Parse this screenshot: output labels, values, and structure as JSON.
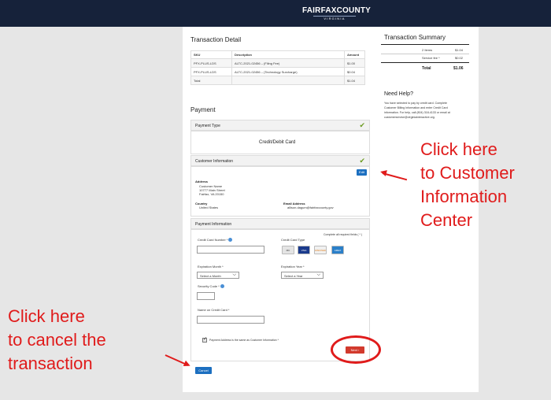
{
  "logo": {
    "main": "FAIRFAXCOUNTY",
    "sub": "VIRGINIA"
  },
  "transaction_detail": {
    "title": "Transaction Detail",
    "columns": [
      "SKU",
      "Description",
      "Amount"
    ],
    "rows": [
      {
        "sku": "PFX-PLUS-LDS",
        "description": "ALTC-2021-02456 – (Filing Fee)",
        "amount": "$1.00"
      },
      {
        "sku": "PFX-PLUS-LDS",
        "description": "ALTC-2021-02456 – (Technology Surcharge)",
        "amount": "$0.04"
      },
      {
        "sku": "Total",
        "description": "",
        "amount": "$1.04"
      }
    ]
  },
  "summary": {
    "title": "Transaction Summary",
    "items_label": "2 Items",
    "items_value": "$1.04",
    "fee_label": "Service fee *",
    "fee_value": "$0.02",
    "total_label": "Total",
    "total_value": "$1.06"
  },
  "help": {
    "title": "Need Help?",
    "body_1": "You have selected to pay by credit card. Complete",
    "body_2": "Customer Billing Information and enter Credit Card",
    "body_3": "information. For help, call (804) 318-4133 or email at",
    "body_4": "customerservice@virginiainteractive.org."
  },
  "payment": {
    "title": "Payment",
    "payment_type_label": "Payment Type",
    "payment_type_value": "Credit/Debit Card",
    "customer_info_label": "Customer Information",
    "edit_label": "Edit",
    "address_label": "Address",
    "address_1": "Customer Name",
    "address_2": "10777 Main Street",
    "address_3": "Fairfax, VA 20150",
    "country_label": "Country",
    "country_value": "United States",
    "email_label": "Email Address",
    "email_value": "allison.dagum@fairfaxcounty.gov",
    "payment_info_label": "Payment Information",
    "required_note": "Complete all required fields ( * )",
    "card_number_label": "Credit Card Number *",
    "card_type_label": "Credit Card Type",
    "exp_month_label": "Expiration Month *",
    "exp_month_value": "Select a Month",
    "exp_year_label": "Expiration Year *",
    "exp_year_value": "Select a Year",
    "security_code_label": "Security Code *",
    "name_label": "Name on Credit Card *",
    "same_address_label": "Payment Address is the same as Customer Information *",
    "next_label": "Next",
    "cancel_label": "Cancel",
    "card_brands": [
      "MC",
      "VISA",
      "DISCOVER",
      "AMEX"
    ]
  },
  "annotations": {
    "right_1": "Click here",
    "right_2": "to Customer",
    "right_3": "Information",
    "right_4": "Center",
    "left_1": "Click here",
    "left_2": "to cancel the",
    "left_3": "transaction"
  },
  "colors": {
    "header": "#16223a",
    "primary": "#1c6fc0",
    "danger": "#d23a2d",
    "annotation": "#e01b1b",
    "check": "#6a9a1f"
  }
}
